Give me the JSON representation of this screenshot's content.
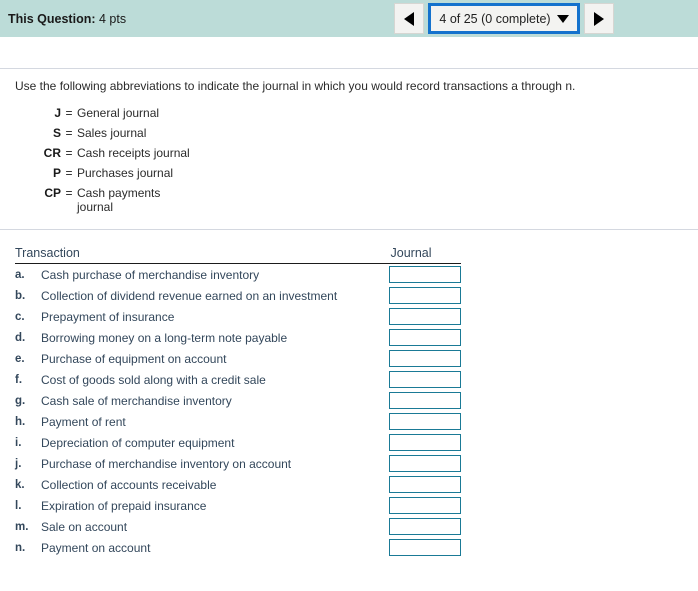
{
  "header": {
    "question_label": "This Question:",
    "question_points": "4 pts",
    "nav": {
      "prev_icon": "triangle-left-icon",
      "next_icon": "triangle-right-icon",
      "selector_text": "4 of 25 (0 complete)",
      "caret_icon": "caret-down-icon",
      "current_question": 4,
      "total_questions": 25,
      "completed": 0,
      "focus_color": "#1472cd"
    },
    "background_color": "#bcdcd8"
  },
  "instructions": {
    "text": "Use the following abbreviations to indicate the journal in which you would record transactions a through n."
  },
  "legend": {
    "equals": "=",
    "items": [
      {
        "abbr": "J",
        "name": "General journal"
      },
      {
        "abbr": "S",
        "name": "Sales journal"
      },
      {
        "abbr": "CR",
        "name": "Cash receipts journal"
      },
      {
        "abbr": "P",
        "name": "Purchases journal"
      },
      {
        "abbr": "CP",
        "name": "Cash payments journal"
      }
    ]
  },
  "table": {
    "columns": {
      "transaction": "Transaction",
      "journal": "Journal"
    },
    "rows": [
      {
        "letter": "a.",
        "description": "Cash purchase of merchandise inventory",
        "answer": ""
      },
      {
        "letter": "b.",
        "description": "Collection of dividend revenue earned on an investment",
        "answer": ""
      },
      {
        "letter": "c.",
        "description": "Prepayment of insurance",
        "answer": ""
      },
      {
        "letter": "d.",
        "description": "Borrowing money on a long-term note payable",
        "answer": ""
      },
      {
        "letter": "e.",
        "description": "Purchase of equipment on account",
        "answer": ""
      },
      {
        "letter": "f.",
        "description": "Cost of goods sold along with a credit sale",
        "answer": ""
      },
      {
        "letter": "g.",
        "description": "Cash sale of merchandise inventory",
        "answer": ""
      },
      {
        "letter": "h.",
        "description": "Payment of rent",
        "answer": ""
      },
      {
        "letter": "i.",
        "description": "Depreciation of computer equipment",
        "answer": ""
      },
      {
        "letter": "j.",
        "description": "Purchase of merchandise inventory on account",
        "answer": ""
      },
      {
        "letter": "k.",
        "description": "Collection of accounts receivable",
        "answer": ""
      },
      {
        "letter": "l.",
        "description": "Expiration of prepaid insurance",
        "answer": ""
      },
      {
        "letter": "m.",
        "description": "Sale on account",
        "answer": ""
      },
      {
        "letter": "n.",
        "description": "Payment on account",
        "answer": ""
      }
    ]
  },
  "colors": {
    "input_border": "#1a7a96",
    "text": "#33475b",
    "divider": "#d4d8e0"
  }
}
